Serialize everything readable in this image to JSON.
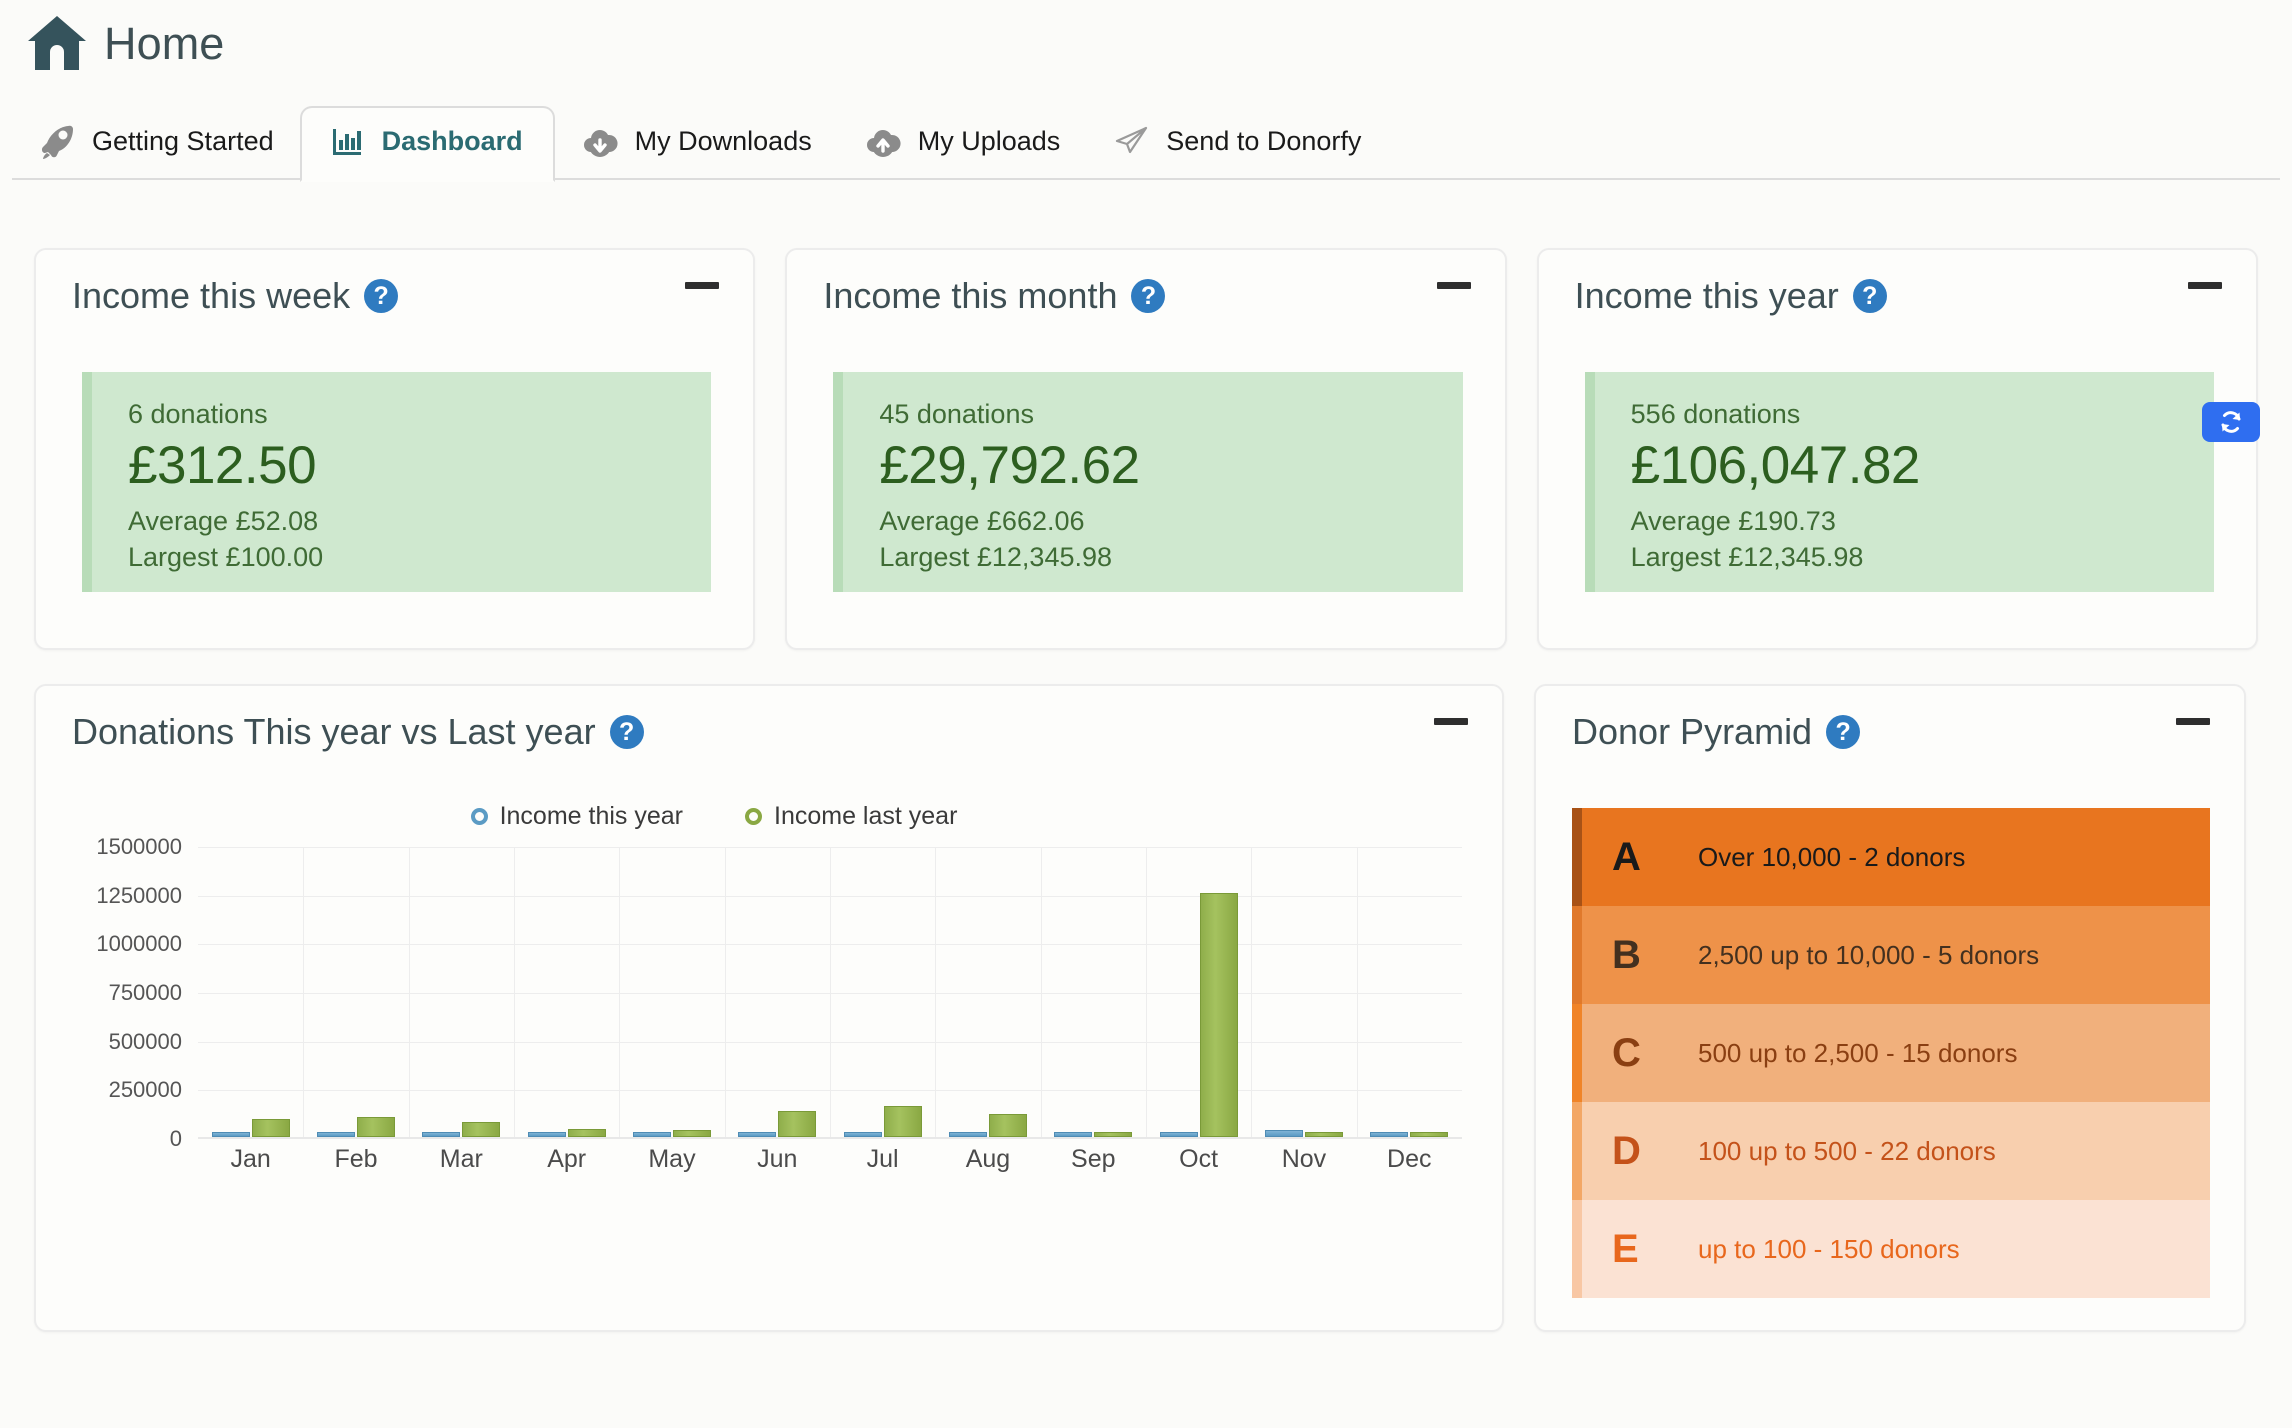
{
  "header": {
    "title": "Home",
    "home_icon": "home-icon"
  },
  "tabs": [
    {
      "label": "Getting Started",
      "icon": "rocket-icon",
      "active": false
    },
    {
      "label": "Dashboard",
      "icon": "bar-chart-icon",
      "active": true
    },
    {
      "label": "My Downloads",
      "icon": "cloud-download-icon",
      "active": false
    },
    {
      "label": "My Uploads",
      "icon": "cloud-upload-icon",
      "active": false
    },
    {
      "label": "Send to Donorfy",
      "icon": "paper-plane-icon",
      "active": false
    }
  ],
  "toolbar": {
    "refresh_icon": "refresh-icon",
    "refresh_color": "#2f6ef0"
  },
  "help_icon_glyph": "?",
  "income_cards": [
    {
      "title": "Income this week",
      "donations": "6 donations",
      "total": "£312.50",
      "average": "Average £52.08",
      "largest": "Largest £100.00"
    },
    {
      "title": "Income this month",
      "donations": "45 donations",
      "total": "£29,792.62",
      "average": "Average £662.06",
      "largest": "Largest £12,345.98"
    },
    {
      "title": "Income this year",
      "donations": "556 donations",
      "total": "£106,047.82",
      "average": "Average £190.73",
      "largest": "Largest £12,345.98"
    }
  ],
  "chart_panel": {
    "title": "Donations This year vs Last year"
  },
  "chart_data": {
    "type": "bar",
    "title": "Donations This year vs Last year",
    "xlabel": "",
    "ylabel": "",
    "grid": true,
    "legend_position": "top-center",
    "ylim": [
      0,
      1500000
    ],
    "yticks": [
      0,
      250000,
      500000,
      750000,
      1000000,
      1250000,
      1500000
    ],
    "ytick_labels": [
      "0",
      "250000",
      "500000",
      "750000",
      "1000000",
      "1250000",
      "1500000"
    ],
    "categories": [
      "Jan",
      "Feb",
      "Mar",
      "Apr",
      "May",
      "Jun",
      "Jul",
      "Aug",
      "Sep",
      "Oct",
      "Nov",
      "Dec"
    ],
    "series": [
      {
        "name": "Income this year",
        "color": "#5b9bc4",
        "values": [
          9000,
          5000,
          16000,
          8000,
          7000,
          7000,
          9000,
          6000,
          11000,
          12000,
          37000,
          5000
        ]
      },
      {
        "name": "Income last year",
        "color": "#8aa843",
        "values": [
          92000,
          103000,
          79000,
          42000,
          38000,
          135000,
          157000,
          120000,
          27000,
          1253000,
          17000,
          22000
        ]
      }
    ]
  },
  "pyramid_panel": {
    "title": "Donor Pyramid"
  },
  "pyramid_rows": [
    {
      "grade": "A",
      "text": "Over 10,000 - 2 donors",
      "bg": "#e8751f",
      "fg": "#1a1a1a",
      "stripe": "#a85216"
    },
    {
      "grade": "B",
      "text": "2,500 up to 10,000 - 5 donors",
      "bg": "#ee9249",
      "fg": "#43301f",
      "stripe": "#e0792b"
    },
    {
      "grade": "C",
      "text": "500 up to 2,500 - 15 donors",
      "bg": "#f1b07c",
      "fg": "#8a3f12",
      "stripe": "#f08428"
    },
    {
      "grade": "D",
      "text": "100 up to 500 - 22 donors",
      "bg": "#f8cfae",
      "fg": "#c4521a",
      "stripe": "#f3a765"
    },
    {
      "grade": "E",
      "text": "up to 100 - 150 donors",
      "bg": "#fbe2d3",
      "fg": "#e8671c",
      "stripe": "#f8c7a4"
    }
  ]
}
